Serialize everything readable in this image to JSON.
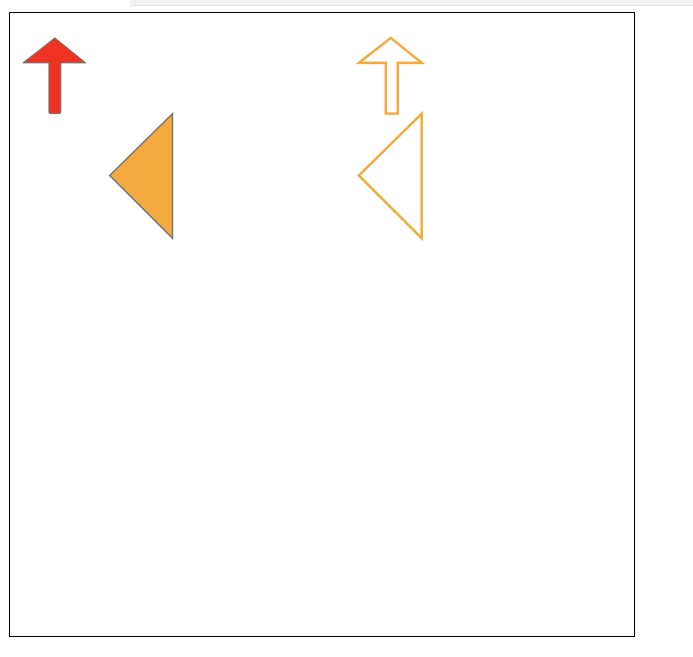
{
  "shapes": [
    {
      "kind": "arrow-up",
      "style": "filled",
      "fill": "#ee3322",
      "stroke": "#777777"
    },
    {
      "kind": "arrow-up",
      "style": "outline",
      "fill": "none",
      "stroke": "#f2ab3c"
    },
    {
      "kind": "triangle-left",
      "style": "filled",
      "fill": "#f2ab3c",
      "stroke": "#777777"
    },
    {
      "kind": "triangle-left",
      "style": "outline",
      "fill": "none",
      "stroke": "#f2ab3c"
    }
  ]
}
